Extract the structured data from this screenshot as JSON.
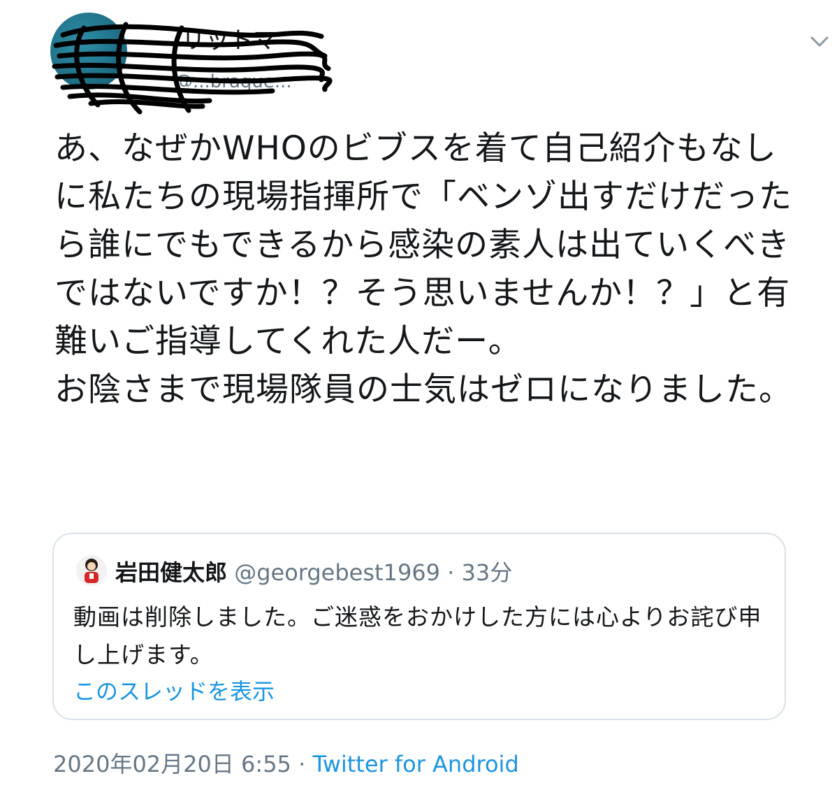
{
  "author": {
    "display_name": "リットマ",
    "handle": "@...braque..."
  },
  "tweet": {
    "text": "あ、なぜかWHOのビブスを着て自己紹介もなしに私たちの現場指揮所で「ベンゾ出すだけだったら誰にでもできるから感染の素人は出ていくべきではないですか！？そう思いませんか！？」と有難いご指導してくれた人だー。\nお陰さまで現場隊員の士気はゼロになりました。",
    "timestamp": "2020年02月20日 6:55",
    "separator": " · ",
    "source": "Twitter for Android"
  },
  "quoted": {
    "name": "岩田健太郎",
    "handle": "@georgebest1969",
    "separator": " · ",
    "time": "33分",
    "text": "動画は削除しました。ご迷惑をおかけした方には心よりお詫び申し上げます。",
    "thread_link": "このスレッドを表示"
  },
  "colors": {
    "link": "#1b95e0",
    "muted": "#657786",
    "text": "#14171a",
    "border": "#d9e1e8"
  },
  "icons": {
    "menu": "chevron-down-icon",
    "avatar": "avatar"
  }
}
